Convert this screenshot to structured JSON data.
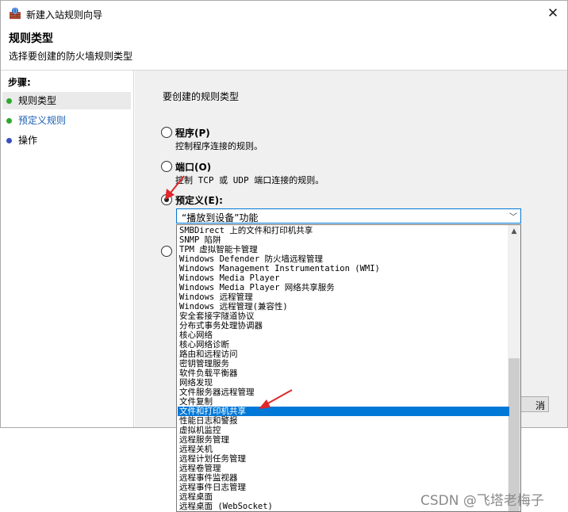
{
  "window": {
    "title": "新建入站规则向导",
    "page_title": "规则类型",
    "page_subtitle": "选择要创建的防火墙规则类型"
  },
  "steps": {
    "heading": "步骤:",
    "items": [
      {
        "label": "规则类型",
        "state": "current",
        "dot_color": "#2ea82e"
      },
      {
        "label": "预定义规则",
        "state": "link",
        "dot_color": "#2ea82e"
      },
      {
        "label": "操作",
        "state": "pending",
        "dot_color": "#3a4fbf"
      }
    ]
  },
  "content": {
    "question": "要创建的规则类型",
    "options": [
      {
        "label": "程序(P)",
        "desc": "控制程序连接的规则。",
        "checked": false
      },
      {
        "label": "端口(O)",
        "desc": "控制 TCP 或 UDP 端口连接的规则。",
        "checked": false
      },
      {
        "label": "预定义(E):",
        "desc": "",
        "checked": true
      }
    ],
    "combo_value": "“播放到设备”功能",
    "button_partial": "消"
  },
  "dropdown": {
    "items": [
      "SMBDirect 上的文件和打印机共享",
      "SNMP 陷阱",
      "TPM 虚拟智能卡管理",
      "Windows Defender 防火墙远程管理",
      "Windows Management Instrumentation (WMI)",
      "Windows Media Player",
      "Windows Media Player 网络共享服务",
      "Windows 远程管理",
      "Windows 远程管理(兼容性)",
      "安全套接字隧道协议",
      "分布式事务处理协调器",
      "核心网络",
      "核心网络诊断",
      "路由和远程访问",
      "密钥管理服务",
      "软件负载平衡器",
      "网络发现",
      "文件服务器远程管理",
      "文件复制",
      "文件和打印机共享",
      "性能日志和警报",
      "虚拟机监控",
      "远程服务管理",
      "远程关机",
      "远程计划任务管理",
      "远程卷管理",
      "远程事件监视器",
      "远程事件日志管理",
      "远程桌面",
      "远程桌面 (WebSocket)"
    ],
    "selected_index": 19
  },
  "watermark": "CSDN @飞塔老梅子",
  "colors": {
    "accent": "#0078d7",
    "annotation_arrow": "#e0272b"
  }
}
